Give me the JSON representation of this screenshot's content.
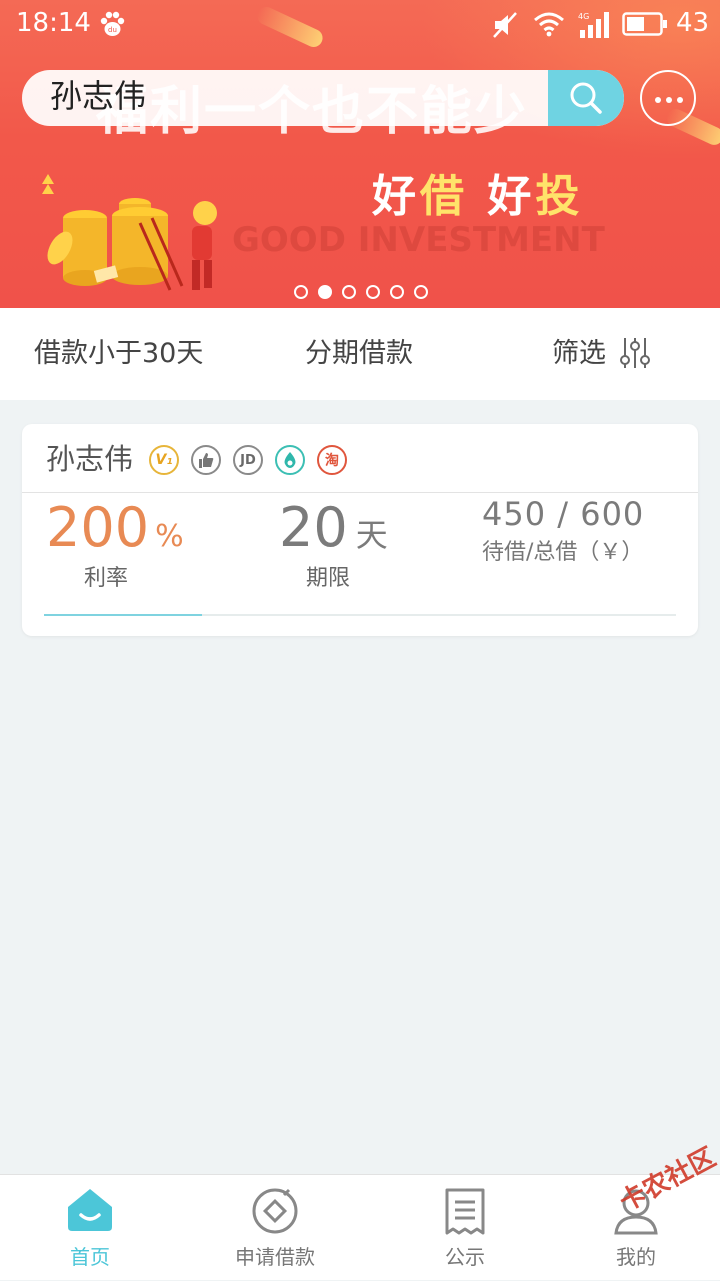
{
  "status_bar": {
    "time": "18:14",
    "battery": "43",
    "icons": [
      "baidu-paw-icon",
      "mute-icon",
      "wifi-icon",
      "signal-icon",
      "battery-icon"
    ]
  },
  "search": {
    "value": "孙志伟"
  },
  "banner": {
    "headline": "福利一个也不能少",
    "slogan_part1": "好",
    "slogan_part2": "借",
    "slogan_part3": " 好",
    "slogan_part4": "投",
    "subtitle": "GOOD INVESTMENT",
    "slide_count": 6,
    "active_slide": 1
  },
  "filters": {
    "short_term": "借款小于30天",
    "installment": "分期借款",
    "filter": "筛选"
  },
  "loan": {
    "borrower": "孙志伟",
    "badges": [
      "vip-badge-icon",
      "thumb-up-badge-icon",
      "jd-badge-icon",
      "drop-badge-icon",
      "taobao-badge-icon"
    ],
    "rate_value": "200",
    "rate_unit": "%",
    "rate_label": "利率",
    "term_value": "20",
    "term_unit": "天",
    "term_label": "期限",
    "amount": "450 / 600",
    "amount_label": "待借/总借（￥）",
    "progress": 0.25
  },
  "colors": {
    "accent": "#4cc6d8",
    "banner_red": "#f2584a",
    "rate_orange": "#e88a54"
  },
  "nav": {
    "home": "首页",
    "apply": "申请借款",
    "notice": "公示",
    "mine": "我的"
  },
  "watermark": "卡农社区"
}
